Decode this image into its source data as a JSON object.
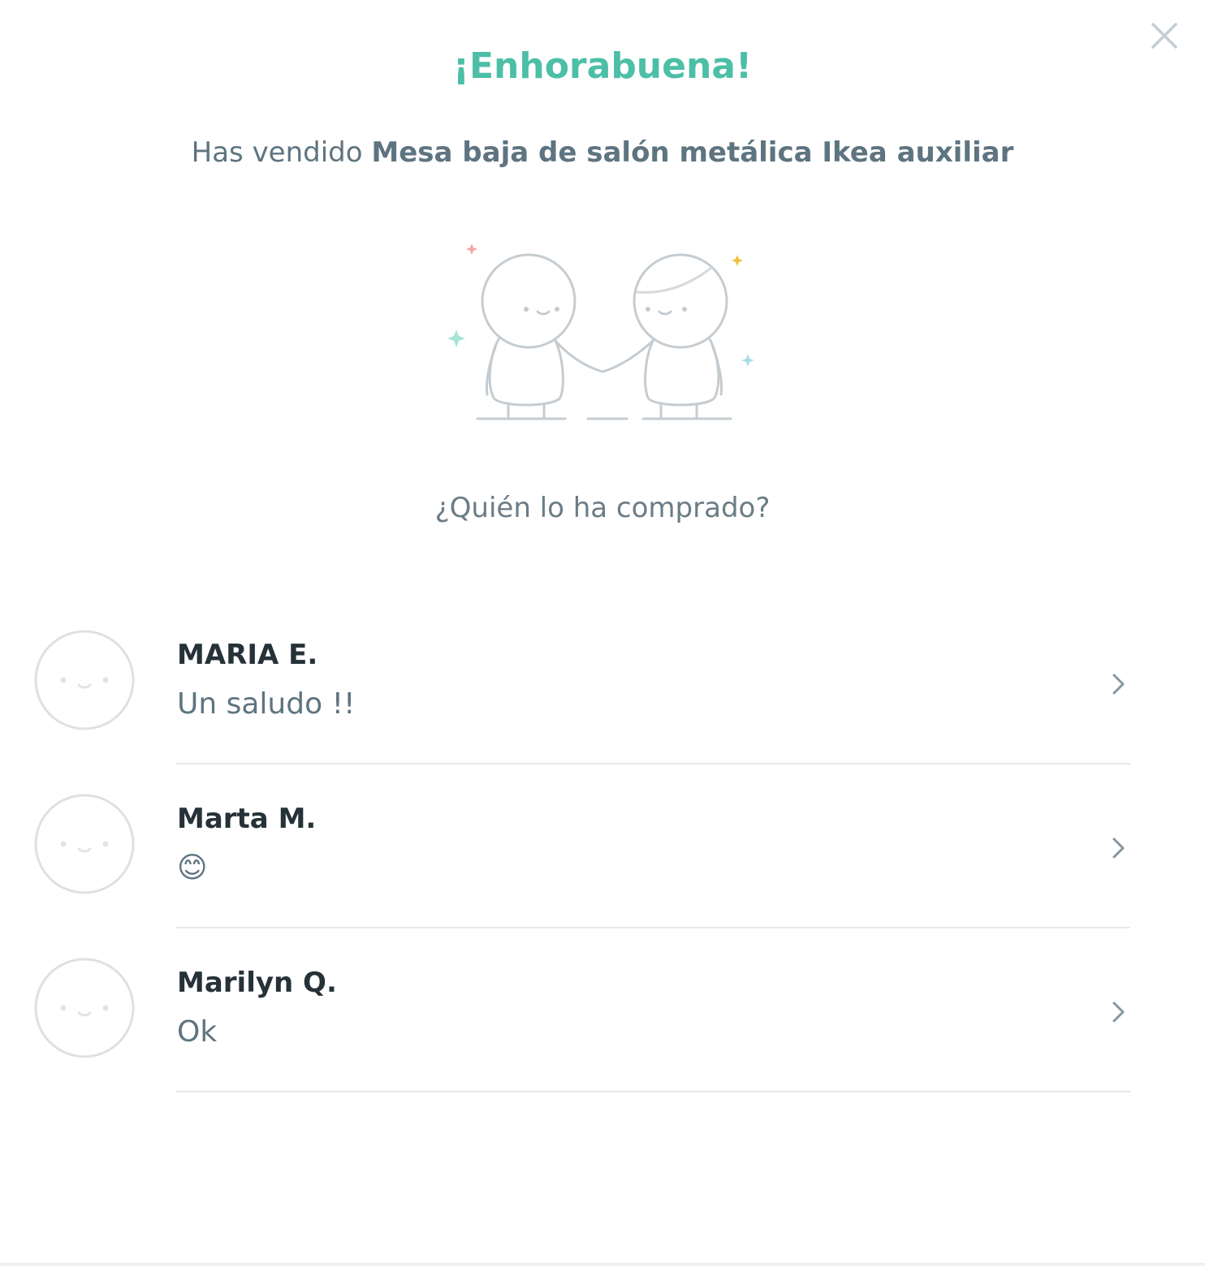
{
  "modal": {
    "title": "¡Enhorabuena!",
    "subtitle_prefix": "Has vendido ",
    "product_name": "Mesa baja de salón metálica Ikea auxiliar",
    "question": "¿Quién lo ha comprado?"
  },
  "icons": {
    "close": "close-icon",
    "chevron": "chevron-right-icon",
    "avatar": "default-avatar-icon",
    "illustration": "handshake-illustration"
  },
  "colors": {
    "title": "#4cbfa6",
    "text": "#5e7480",
    "name": "#253238",
    "divider": "#e4e8ea"
  },
  "buyers": [
    {
      "name": "MARIA E.",
      "message": "Un saludo !!"
    },
    {
      "name": "Marta M.",
      "message": "😊"
    },
    {
      "name": "Marilyn Q.",
      "message": "Ok"
    }
  ]
}
